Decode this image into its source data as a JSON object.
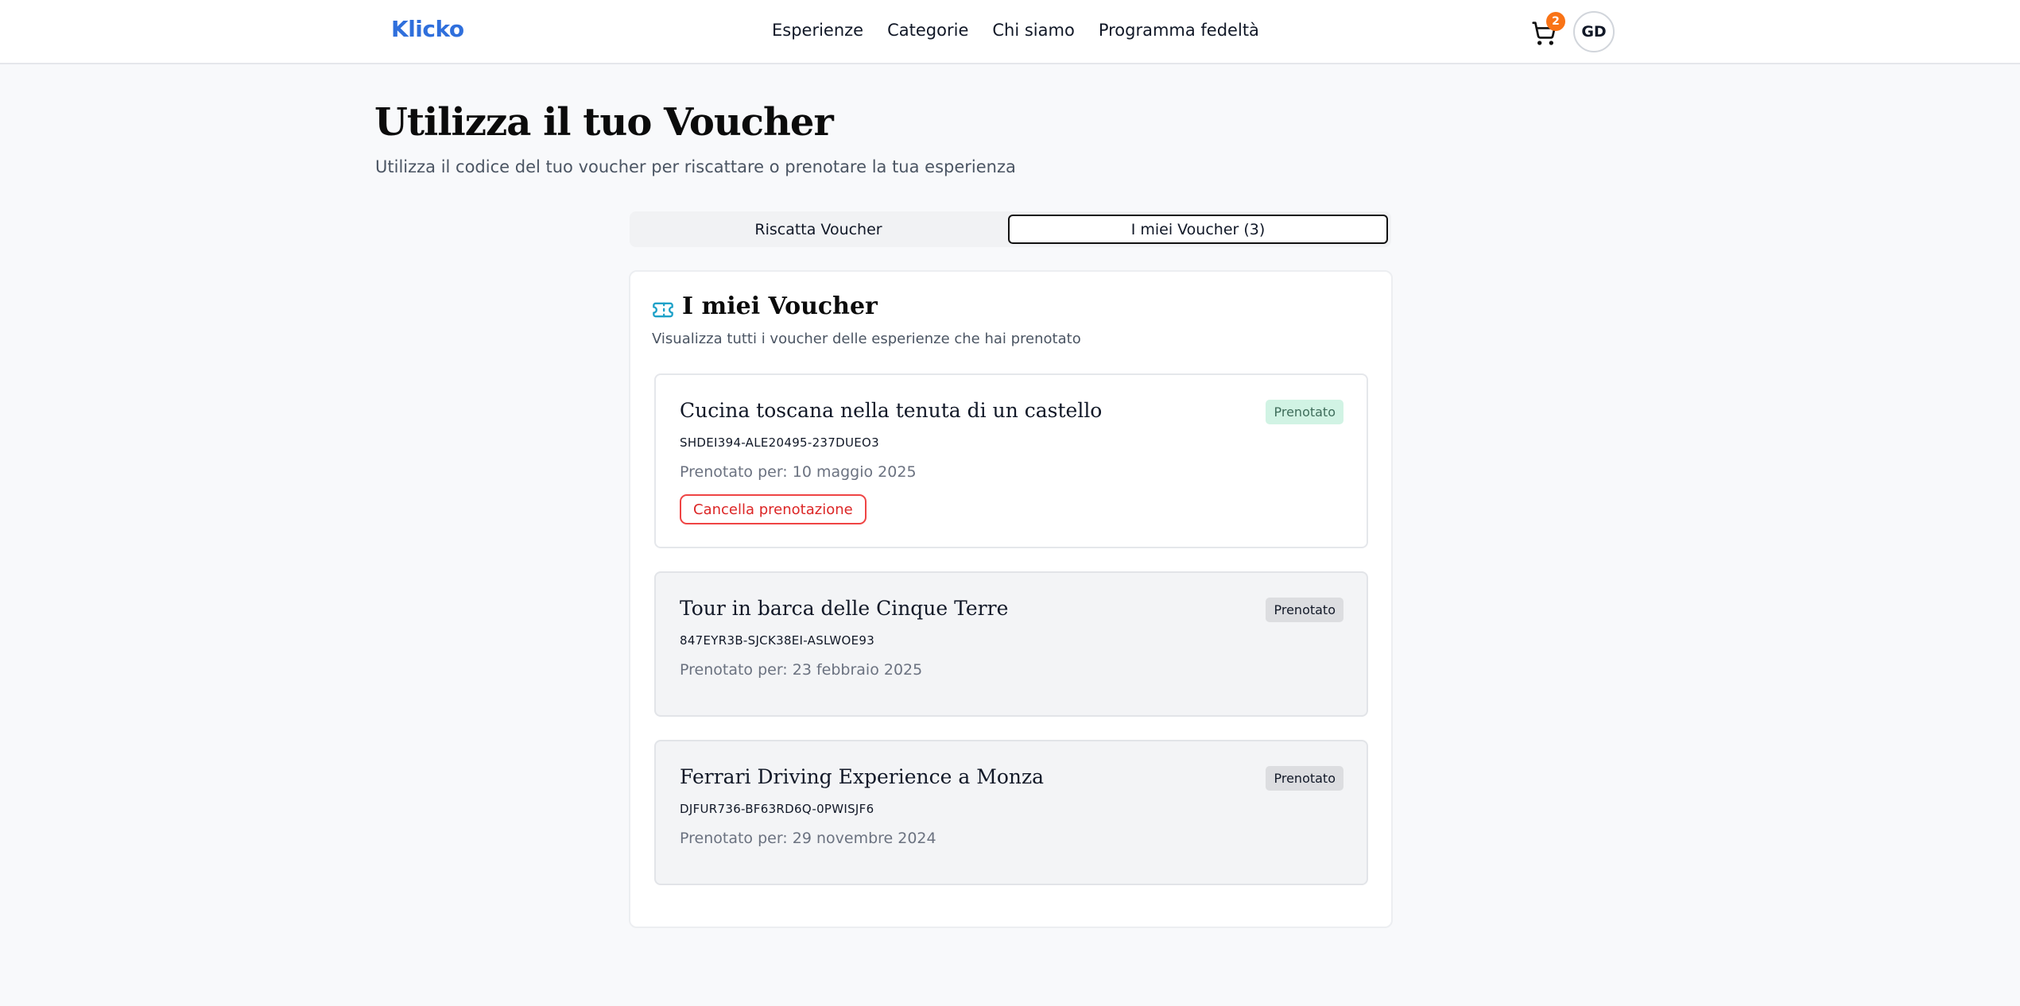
{
  "header": {
    "logo": "Klicko",
    "nav": [
      "Esperienze",
      "Categorie",
      "Chi siamo",
      "Programma fedeltà"
    ],
    "cart_count": "2",
    "avatar_initials": "GD",
    "icons": [
      "cart-icon"
    ]
  },
  "page": {
    "title": "Utilizza il tuo Voucher",
    "subtitle": "Utilizza il codice del tuo voucher per riscattare o prenotare la tua esperienza"
  },
  "tabs": {
    "redeem": "Riscatta Voucher",
    "mine": "I miei Voucher (3)",
    "active": "mine"
  },
  "card": {
    "icon": "ticket-icon",
    "title": "I miei Voucher",
    "description": "Visualizza tutti i voucher delle esperienze che hai prenotato"
  },
  "vouchers": [
    {
      "title": "Cucina toscana nella tenuta di un castello",
      "code": "SHDEI394-ALE20495-237DUEO3",
      "date": "Prenotato per: 10 maggio 2025",
      "status": "Prenotato",
      "status_color": "#d1f3e4",
      "cancel_label": "Cancella prenotazione"
    },
    {
      "title": "Tour in barca delle Cinque Terre",
      "code": "847EYR3B-SJCK38EI-ASLWOE93",
      "date": "Prenotato per: 23 febbraio 2025",
      "status": "Prenotato",
      "status_color": "#dcdde0"
    },
    {
      "title": "Ferrari Driving Experience a Monza",
      "code": "DJFUR736-BF63RD6Q-0PWISJF6",
      "date": "Prenotato per: 29 novembre 2024",
      "status": "Prenotato",
      "status_color": "#dcdde0"
    }
  ],
  "colors": {
    "brand": "#2f6fdc",
    "badge_orange": "#f97316",
    "cancel_red": "#dc2626"
  }
}
